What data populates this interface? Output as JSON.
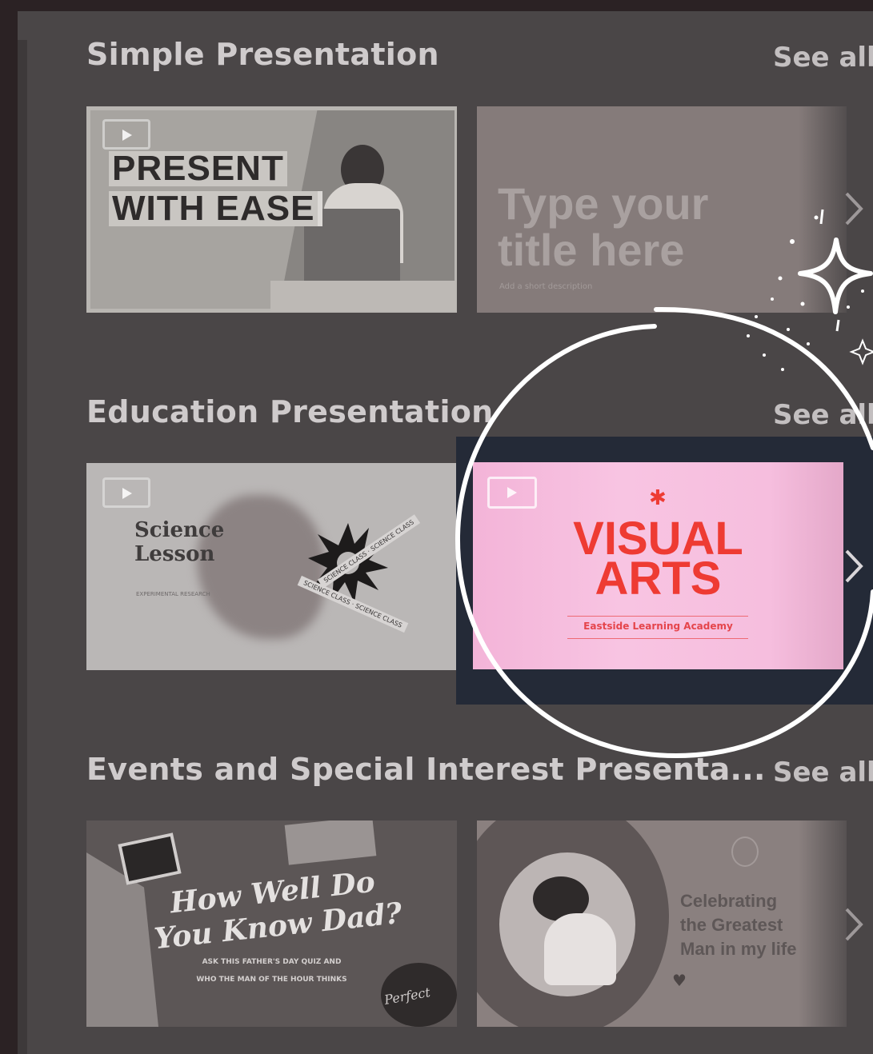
{
  "sections": [
    {
      "title": "Simple Presentation",
      "see_all": "See all",
      "cards": [
        {
          "heading_line1": "PRESENT",
          "heading_line2": "WITH EASE"
        },
        {
          "heading_line1": "Type your",
          "heading_line2": "title here",
          "subtitle": "Add a short description"
        }
      ]
    },
    {
      "title": "Education Presentation",
      "see_all": "See all",
      "cards": [
        {
          "heading_line1": "Science",
          "heading_line2": "Lesson",
          "subtitle": "EXPERIMENTAL RESEARCH",
          "ribbon1": "SCIENCE CLASS · SCIENCE CLASS",
          "ribbon2": "SCIENCE CLASS · SCIENCE CLASS"
        },
        {
          "heading_line1": "VISUAL",
          "heading_line2": "ARTS",
          "subtitle": "Eastside Learning Academy"
        }
      ]
    },
    {
      "title": "Events and Special Interest Presenta...",
      "see_all": "See all",
      "cards": [
        {
          "heading_line1": "How Well Do",
          "heading_line2": "You Know Dad?",
          "subtitle1": "ASK THIS FATHER'S DAY QUIZ AND",
          "subtitle2": "WHO THE MAN OF THE HOUR THINKS",
          "stamp": "Perfect"
        },
        {
          "heading_line1": "Celebrating",
          "heading_line2": "the Greatest",
          "heading_line3": "Man in my life"
        }
      ]
    }
  ],
  "colors": {
    "background": "#2b2224",
    "panel": "#4a4647",
    "title": "#cfcbcc",
    "highlight_bg": "#242a37",
    "visual_arts_pink": "#f7bfe0",
    "visual_arts_red": "#ee3b33"
  },
  "icons": [
    "play-icon",
    "chevron-right-icon",
    "sparkle-icon"
  ]
}
